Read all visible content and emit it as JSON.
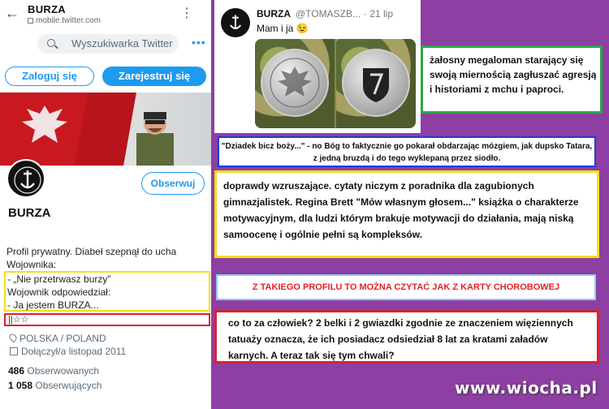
{
  "browser": {
    "title": "BURZA",
    "url": "mobile.twitter.com"
  },
  "twitter": {
    "search_placeholder": "Wyszukiwarka Twitter",
    "login_label": "Zaloguj się",
    "signup_label": "Zarejestruj się",
    "follow_label": "Obserwuj",
    "profile_name": "BURZA",
    "bio_line1": "Profil prywatny.  Diabeł szepnął do ucha",
    "bio_line2": "Wojownika:",
    "bio_box": [
      "- „Nie przetrwasz burzy”",
      "Wojownik odpowiedział:",
      "- Ja jestem BURZA..."
    ],
    "symbols": "||☆☆",
    "location": "POLSKA / POLAND",
    "joined": "Dołączył/a listopad 2011",
    "following_count": "486",
    "following_label": "Obserwowanych",
    "followers_count": "1 058",
    "followers_label": "Obserwujących"
  },
  "tweet": {
    "name": "BURZA",
    "handle": "@TOMASZB...",
    "date": "· 21 lip",
    "text": "Mam i ja 😉"
  },
  "comments": {
    "green": "żałosny megaloman starający się swoją miernością zagłuszać agresją i historiami z mchu i paproci.",
    "quote": "\"Dziadek bicz boży...\" - no Bóg to faktycznie go pokarał obdarzając mózgiem, jak dupsko Tatara, z jedną bruzdą i do tego wyklepaną przez siodło.",
    "yellow": "doprawdy wzruszające. cytaty niczym z poradnika dla zagubionych gimnazjalistek. Regina Brett \"Mów własnym głosem...\" książka o charakterze motywacyjnym, dla ludzi którym brakuje motywacji do działania, mają niską samoocenę i ogólnie pełni są kompleksów.",
    "label": "Z TAKIEGO PROFILU TO MOŻNA CZYTAĆ JAK Z KARTY CHOROBOWEJ",
    "red": "co to za człowiek? 2 belki i 2 gwiazdki zgodnie ze znaczeniem więziennych tatuaży oznacza, że ich posiadacz odsiedział 8 lat za kratami załadów karnych. A teraz tak się tym chwali?"
  },
  "watermark": "www.wiocha.pl"
}
